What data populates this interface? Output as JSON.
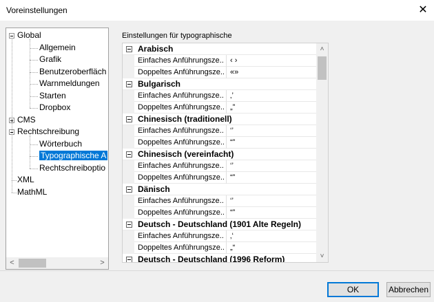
{
  "window": {
    "title": "Voreinstellungen"
  },
  "tree": {
    "items": [
      {
        "label": "Global",
        "level": 0,
        "expander": "minus"
      },
      {
        "label": "Allgemein",
        "level": 1
      },
      {
        "label": "Grafik",
        "level": 1
      },
      {
        "label": "Benutzeroberfläch",
        "level": 1
      },
      {
        "label": "Warnmeldungen",
        "level": 1
      },
      {
        "label": "Starten",
        "level": 1
      },
      {
        "label": "Dropbox",
        "level": 1
      },
      {
        "label": "CMS",
        "level": 0,
        "expander": "plus"
      },
      {
        "label": "Rechtschreibung",
        "level": 0,
        "expander": "minus"
      },
      {
        "label": "Wörterbuch",
        "level": 1
      },
      {
        "label": "Typographische A",
        "level": 1,
        "selected": true
      },
      {
        "label": "Rechtschreiboptio",
        "level": 1
      },
      {
        "label": "XML",
        "level": 0
      },
      {
        "label": "MathML",
        "level": 0
      }
    ],
    "scroll_left": "<",
    "scroll_right": ">"
  },
  "grid": {
    "group_label": "Einstellungen für typographische",
    "categories": [
      {
        "name": "Arabisch",
        "props": [
          {
            "name": "Einfaches Anführungsze...",
            "value": "‹ ›"
          },
          {
            "name": "Doppeltes Anführungsze...",
            "value": "«»"
          }
        ]
      },
      {
        "name": "Bulgarisch",
        "props": [
          {
            "name": "Einfaches Anführungsze...",
            "value": "‚’"
          },
          {
            "name": "Doppeltes Anführungsze...",
            "value": "„”"
          }
        ]
      },
      {
        "name": "Chinesisch (traditionell)",
        "props": [
          {
            "name": "Einfaches Anführungsze...",
            "value": "‘’"
          },
          {
            "name": "Doppeltes Anführungsze...",
            "value": "“”"
          }
        ]
      },
      {
        "name": "Chinesisch (vereinfacht)",
        "props": [
          {
            "name": "Einfaches Anführungsze...",
            "value": "‘’"
          },
          {
            "name": "Doppeltes Anführungsze...",
            "value": "“”"
          }
        ]
      },
      {
        "name": "Dänisch",
        "props": [
          {
            "name": "Einfaches Anführungsze...",
            "value": "‘’"
          },
          {
            "name": "Doppeltes Anführungsze...",
            "value": "“”"
          }
        ]
      },
      {
        "name": "Deutsch - Deutschland (1901 Alte Regeln)",
        "props": [
          {
            "name": "Einfaches Anführungsze...",
            "value": "‚‘"
          },
          {
            "name": "Doppeltes Anführungsze...",
            "value": "„“"
          }
        ]
      },
      {
        "name": "Deutsch - Deutschland (1996 Reform)",
        "props": []
      }
    ],
    "scroll_up": "˄",
    "scroll_down": "˅"
  },
  "buttons": {
    "ok": "OK",
    "cancel": "Abbrechen"
  }
}
